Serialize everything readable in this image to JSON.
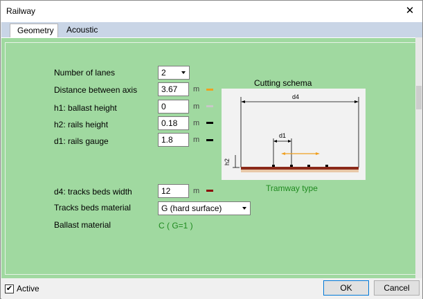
{
  "window": {
    "title": "Railway",
    "close_symbol": "✕"
  },
  "tabs": [
    {
      "label": "Geometry",
      "active": true
    },
    {
      "label": "Acoustic",
      "active": false
    }
  ],
  "fields": {
    "lanes": {
      "label": "Number of lanes",
      "value": "2"
    },
    "axis_distance": {
      "label": "Distance between axis",
      "value": "3.67",
      "unit": "m",
      "color": "#f0a020"
    },
    "h1": {
      "label": "h1: ballast height",
      "value": "0",
      "unit": "m",
      "color": "#c8c8c8"
    },
    "h2": {
      "label": "h2: rails height",
      "value": "0.18",
      "unit": "m",
      "color": "#000000"
    },
    "d1": {
      "label": "d1: rails gauge",
      "value": "1.8",
      "unit": "m",
      "color": "#000000"
    },
    "d4": {
      "label": "d4: tracks beds width",
      "value": "12",
      "unit": "m",
      "color": "#8b0000"
    },
    "beds_material": {
      "label": "Tracks beds material",
      "value": "G (hard surface)"
    },
    "ballast_material": {
      "label": "Ballast material",
      "value": "C  ( G=1 )"
    }
  },
  "schema": {
    "title": "Cutting schema",
    "type_label": "Tramway type",
    "d4_label": "d4",
    "d1_label": "d1",
    "h2_label": "h2",
    "colors": {
      "bed": "#8b2a1a",
      "ballast": "#e8c8a8",
      "arrow": "#f0a020",
      "rail": "#000000"
    }
  },
  "footer": {
    "active_label": "Active",
    "active_checked": true,
    "check_symbol": "✔",
    "ok_label": "OK",
    "cancel_label": "Cancel"
  },
  "colors": {
    "panel_bg": "#a0d9a0",
    "tab_strip": "#c9d5e6",
    "accent_text": "#1f8a1f"
  }
}
